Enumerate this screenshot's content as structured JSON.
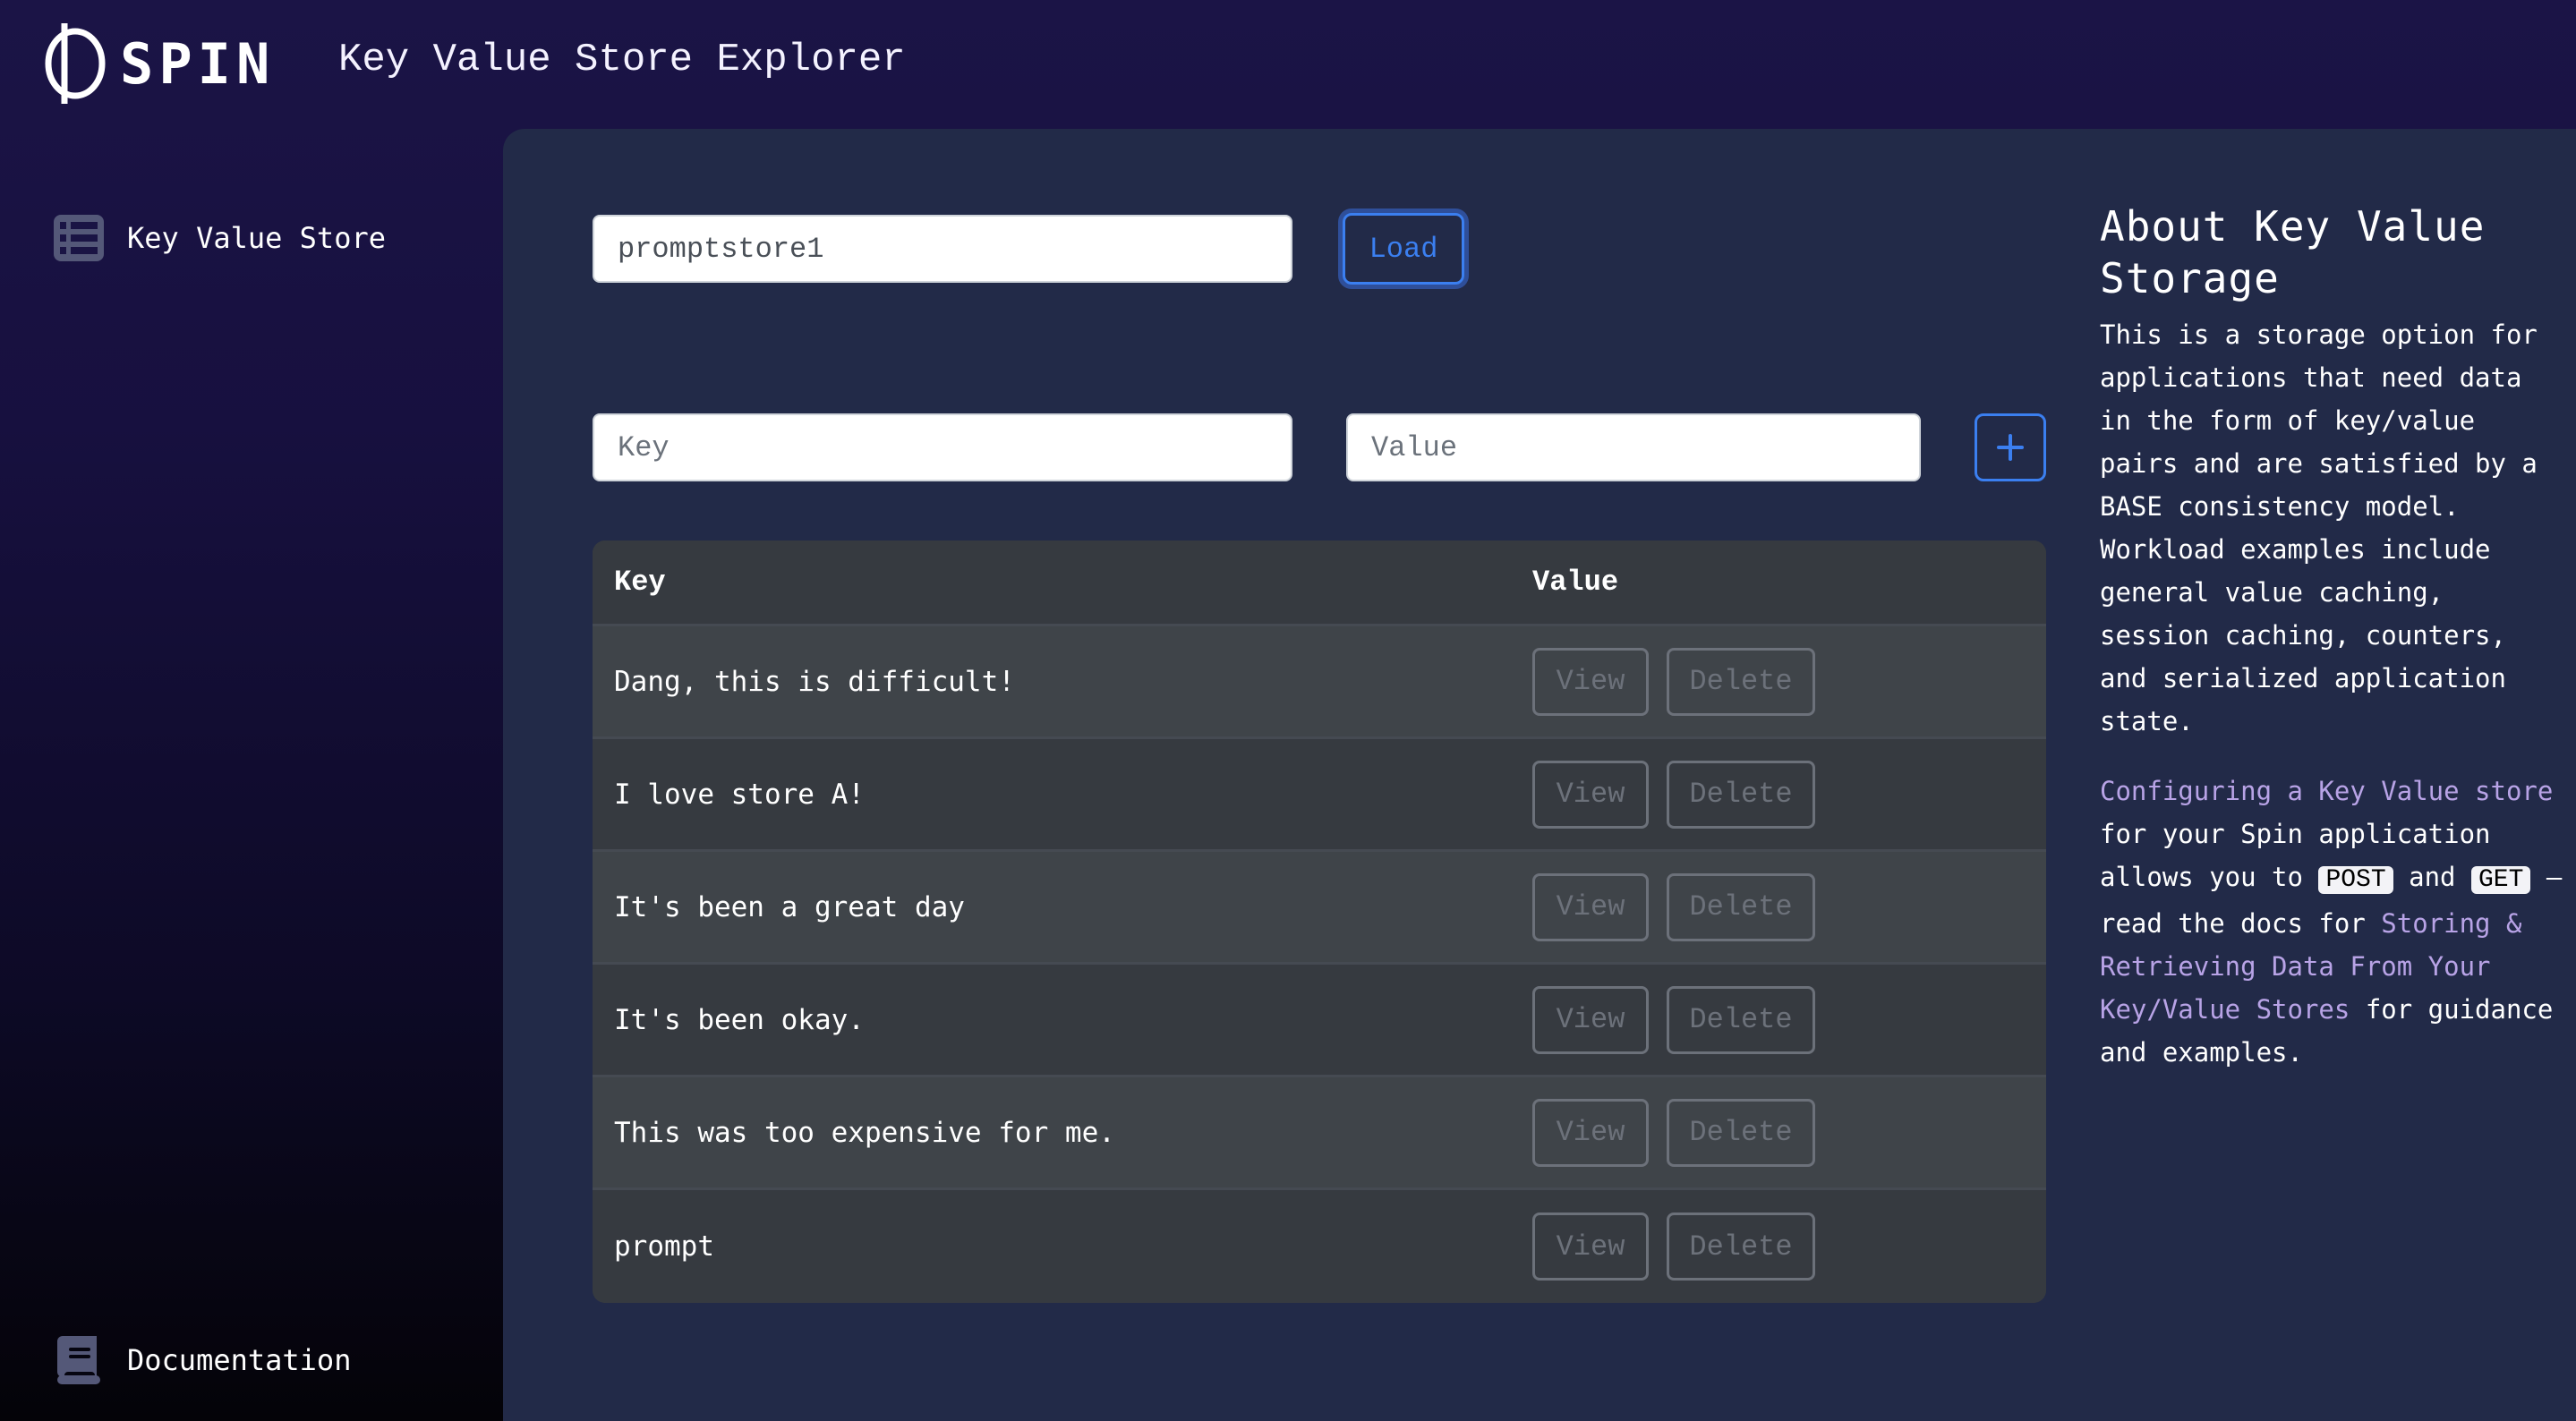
{
  "header": {
    "brand": "SPIN",
    "title": "Key Value Store Explorer"
  },
  "sidebar": {
    "items": [
      {
        "label": "Key Value Store",
        "icon": "table-list-icon"
      },
      {
        "label": "Documentation",
        "icon": "book-icon"
      }
    ]
  },
  "store": {
    "input_value": "promptstore1",
    "load_label": "Load"
  },
  "add_form": {
    "key_placeholder": "Key",
    "value_placeholder": "Value",
    "add_label": "+"
  },
  "table": {
    "headers": {
      "key": "Key",
      "value": "Value"
    },
    "view_label": "View",
    "delete_label": "Delete",
    "rows": [
      {
        "key": "Dang, this is difficult!"
      },
      {
        "key": "I love store A!"
      },
      {
        "key": "It's been a great day"
      },
      {
        "key": "It's been okay."
      },
      {
        "key": "This was too expensive for me."
      },
      {
        "key": "prompt"
      }
    ]
  },
  "about": {
    "title": "About Key Value Storage",
    "description": "This is a storage option for applications that need data in the form of key/value pairs and are satisfied by a BASE consistency model. Workload examples include general value caching, session caching, counters, and serialized application state.",
    "link1": "Configuring a Key Value store",
    "text1": " for your Spin application allows you to ",
    "code_post": "POST",
    "text_and": " and ",
    "code_get": "GET",
    "text2": " — read the docs for ",
    "link2": "Storing & Retrieving Data From Your Key/Value Stores",
    "text3": " for guidance and examples."
  },
  "colors": {
    "accent_blue": "#3b7ff0",
    "link_purple": "#b8a3e6",
    "panel_bg": "#222a48",
    "header_bg": "#1b1446"
  }
}
